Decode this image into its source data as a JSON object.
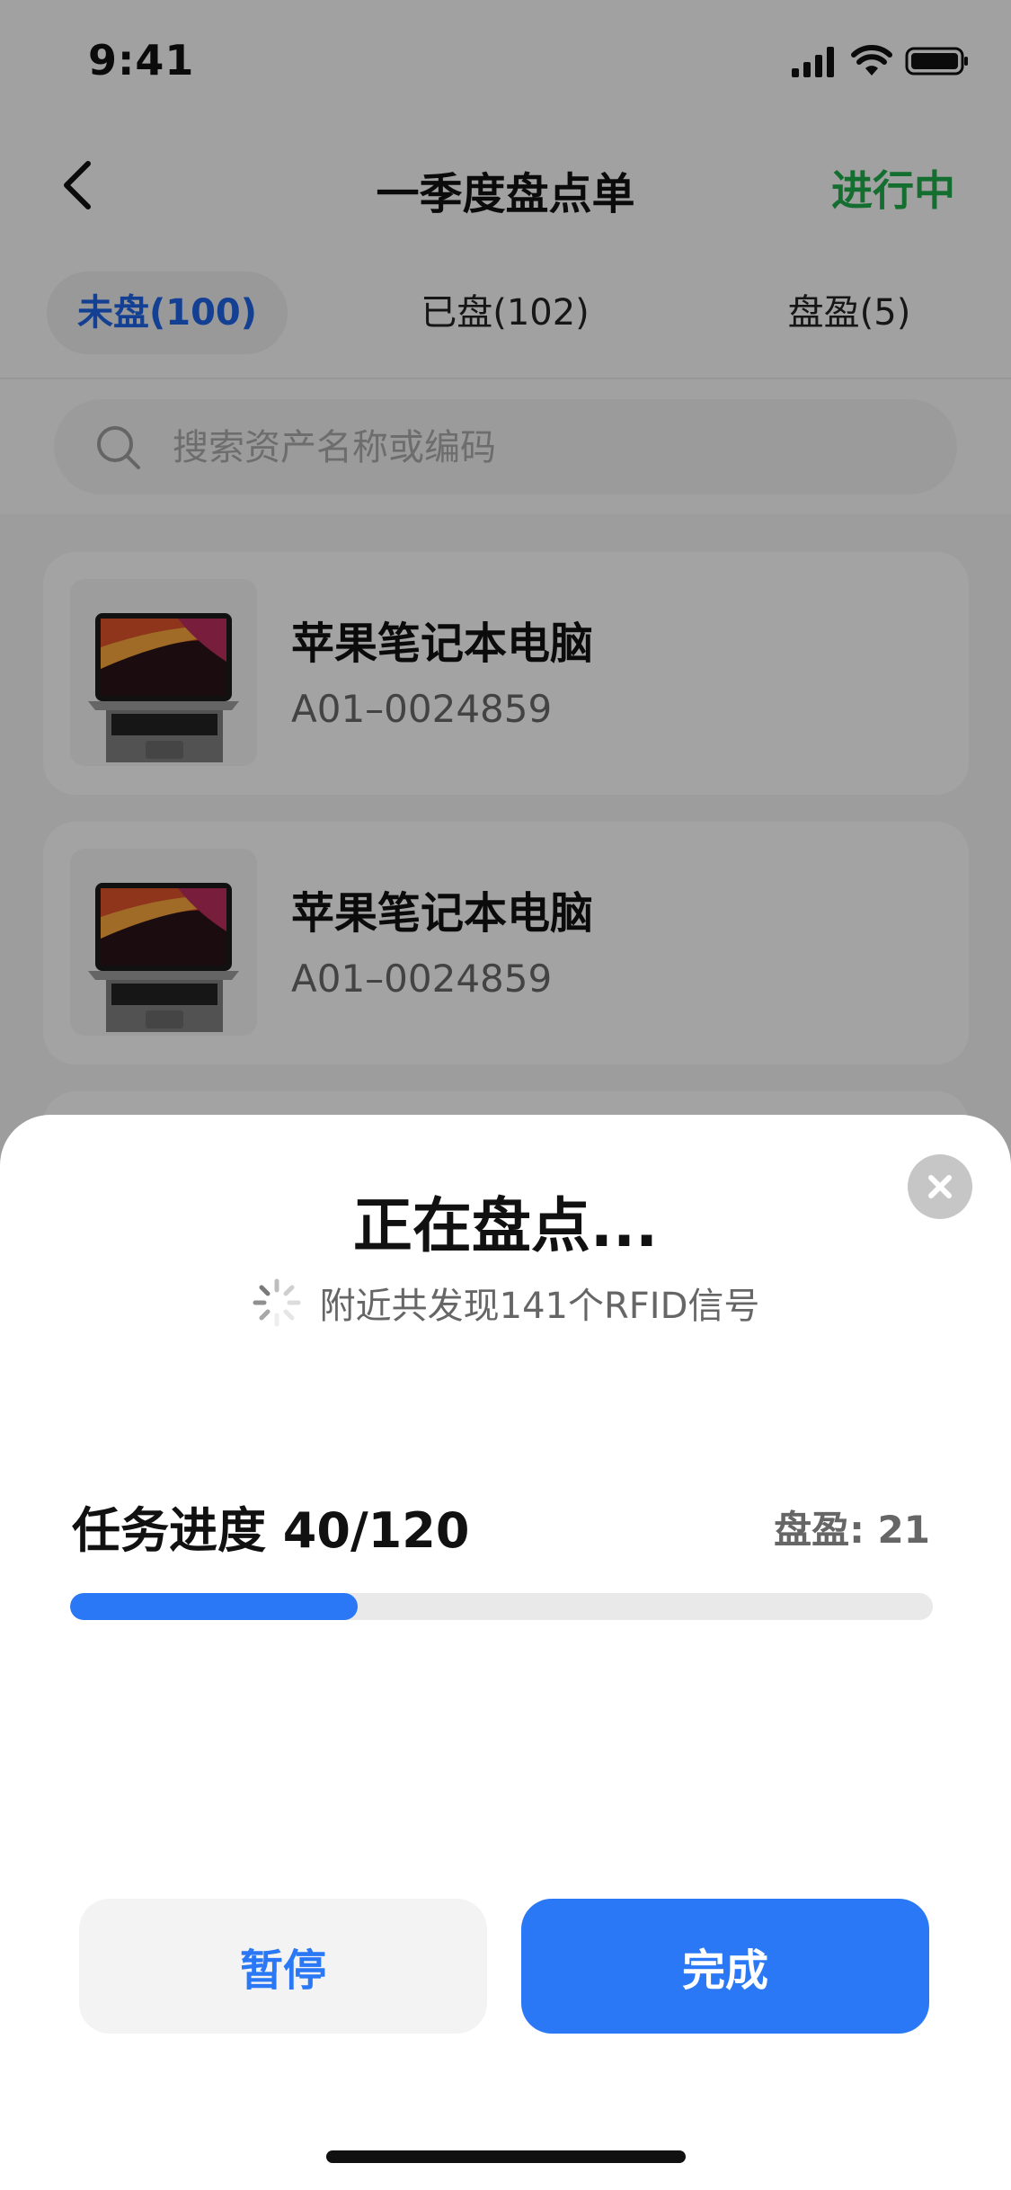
{
  "status_bar": {
    "time": "9:41"
  },
  "nav": {
    "title": "一季度盘点单",
    "status": "进行中"
  },
  "tabs": [
    {
      "label": "未盘(100)",
      "active": true
    },
    {
      "label": "已盘(102)",
      "active": false
    },
    {
      "label": "盘盈(5)",
      "active": false
    }
  ],
  "search": {
    "placeholder": "搜索资产名称或编码"
  },
  "items": [
    {
      "name": "苹果笔记本电脑",
      "code": "A01–0024859"
    },
    {
      "name": "苹果笔记本电脑",
      "code": "A01–0024859"
    }
  ],
  "sheet": {
    "title": "正在盘点...",
    "scan_status": "附近共发现141个RFID信号",
    "progress_label": "任务进度 40/120",
    "progress_done": 40,
    "progress_total": 120,
    "surplus_text": "盘盈: 21",
    "pause_label": "暂停",
    "done_label": "完成"
  },
  "colors": {
    "primary": "#2a78f6",
    "active_tab": "#1f62e0",
    "status_green": "#1fa84a",
    "overlay": "rgba(0,0,0,0.34)"
  },
  "icons": [
    "back-chevron-icon",
    "signal-icon",
    "wifi-icon",
    "battery-icon",
    "search-icon",
    "close-icon",
    "loading-spinner-icon",
    "laptop-image"
  ]
}
